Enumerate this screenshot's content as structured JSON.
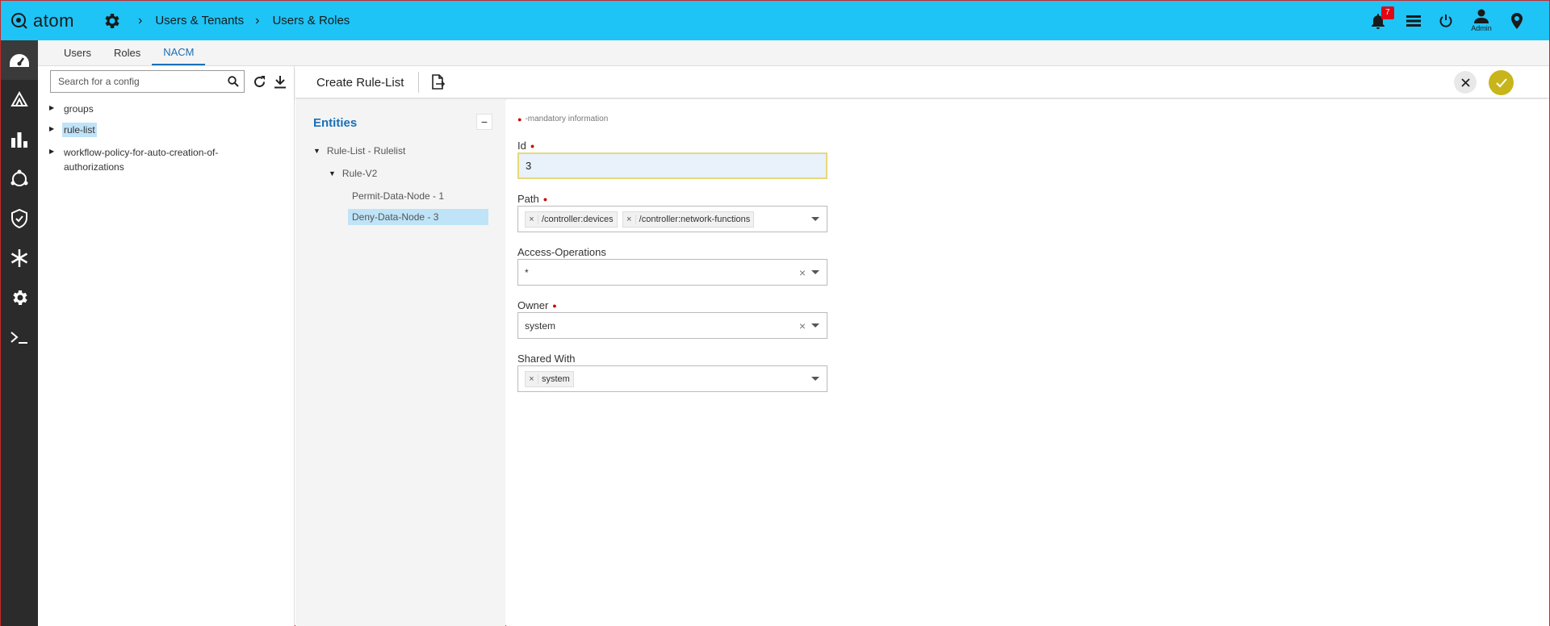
{
  "app": {
    "logo_text": "atom",
    "breadcrumb": [
      "Users & Tenants",
      "Users & Roles"
    ],
    "notification_count": "7",
    "user_label": "Admin",
    "header_icons": [
      "bell-icon",
      "list-icon",
      "power-icon",
      "user-icon",
      "location-pin-icon"
    ],
    "accent_color": "#1ec4f5"
  },
  "rail": {
    "items": [
      "dashboard-icon",
      "devices-icon",
      "analytics-icon",
      "network-icon",
      "security-icon",
      "snowflake-icon",
      "settings-icon",
      "terminal-icon"
    ]
  },
  "tabs": [
    {
      "label": "Users"
    },
    {
      "label": "Roles"
    },
    {
      "label": "NACM",
      "active": true
    }
  ],
  "tree": {
    "search_placeholder": "Search for a config",
    "nodes": [
      {
        "label": "groups"
      },
      {
        "label": "rule-list",
        "selected": true
      },
      {
        "label": "workflow-policy-for-auto-creation-of-authorizations"
      }
    ]
  },
  "toolbar": {
    "title": "Create Rule-List"
  },
  "entities": {
    "title": "Entities",
    "collapse_symbol": "−",
    "nodes": [
      {
        "label": "Rule-List - Rulelist"
      },
      {
        "label": "Rule-V2"
      },
      {
        "label": "Permit-Data-Node - 1"
      },
      {
        "label": "Deny-Data-Node - 3",
        "selected": true
      }
    ]
  },
  "form": {
    "mandatory_note": "-mandatory information",
    "fields": {
      "id": {
        "label": "Id",
        "value": "3"
      },
      "path": {
        "label": "Path",
        "chips": [
          "/controller:devices",
          "/controller:network-functions"
        ]
      },
      "access_operations": {
        "label": "Access-Operations",
        "value": "*"
      },
      "owner": {
        "label": "Owner",
        "value": "system"
      },
      "shared_with": {
        "label": "Shared With",
        "chips": [
          "system"
        ]
      }
    }
  }
}
